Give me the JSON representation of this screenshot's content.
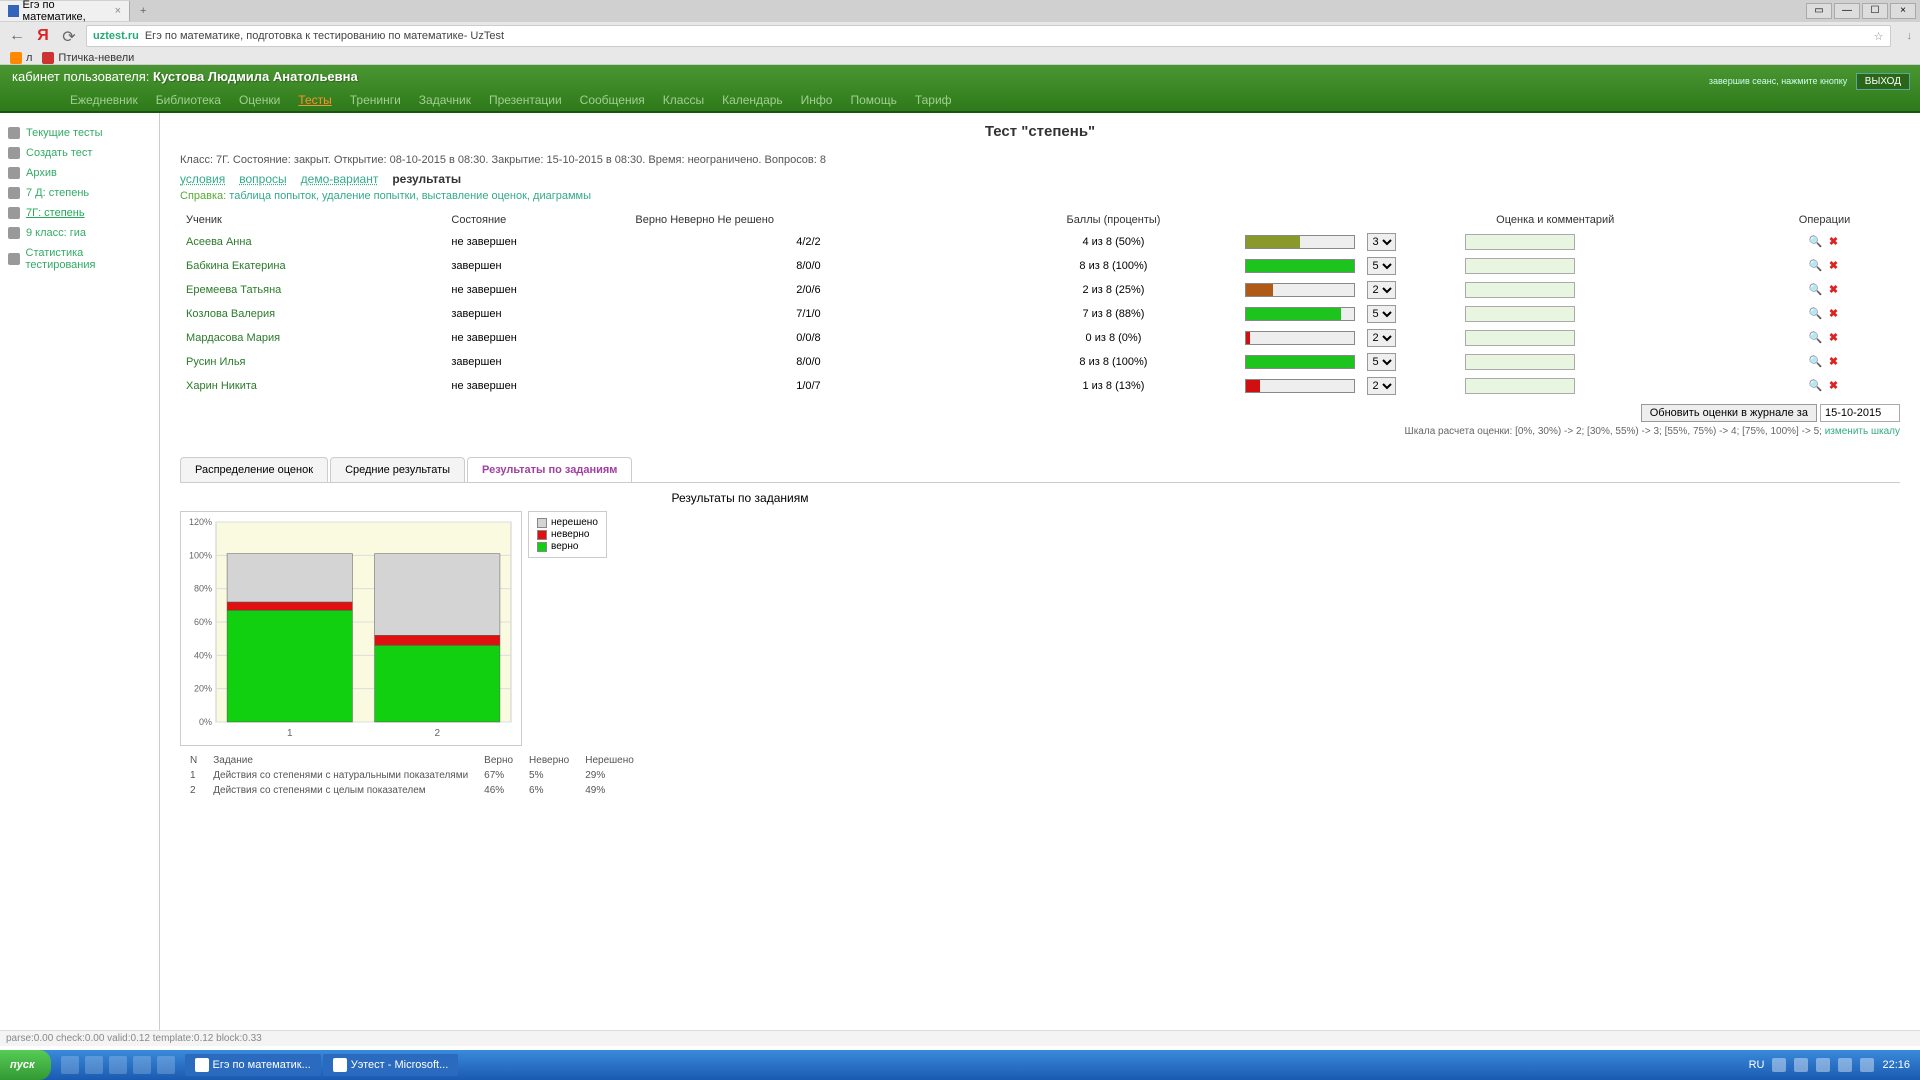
{
  "browser": {
    "tab_title": "Егэ по математике,",
    "url_domain": "uztest.ru",
    "url_title": "Егэ по математике, подготовка к тестированию по математике- UzTest",
    "bookmarks": [
      {
        "label": "л",
        "color": "#f80"
      },
      {
        "label": "Птичка-невели",
        "color": "#c33"
      }
    ]
  },
  "header": {
    "user_label": "кабинет пользователя:",
    "user_name": "Кустова Людмила Анатольевна",
    "logout_hint": "завершив сеанс, нажмите кнопку",
    "logout_btn": "ВЫХОД",
    "menu": [
      "Ежедневник",
      "Библиотека",
      "Оценки",
      "Тесты",
      "Тренинги",
      "Задачник",
      "Презентации",
      "Сообщения",
      "Классы",
      "Календарь",
      "Инфо",
      "Помощь",
      "Тариф"
    ],
    "menu_active": 3
  },
  "sidebar": [
    "Текущие тесты",
    "Создать тест",
    "Архив",
    "7 Д: степень",
    "7Г: степень",
    "9 класс: гиа",
    "Статистика тестирования"
  ],
  "sidebar_active": 4,
  "test": {
    "title": "Тест \"степень\"",
    "info": "Класс: 7Г. Состояние: закрыт. Открытие: 08-10-2015 в 08:30. Закрытие: 15-10-2015 в 08:30. Время: неограничено. Вопросов: 8",
    "subtabs": [
      "условия",
      "вопросы",
      "демо-вариант",
      "результаты"
    ],
    "subtab_active": 3,
    "help_label": "Справка:",
    "help_text": "таблица попыток, удаление попытки, выставление оценок, диаграммы"
  },
  "table": {
    "headers": {
      "student": "Ученик",
      "state": "Состояние",
      "vnr": "Верно Неверно Не решено",
      "points": "Баллы (проценты)",
      "grade": "Оценка и комментарий",
      "ops": "Операции"
    },
    "rows": [
      {
        "name": "Асеева Анна",
        "state": "не завершен",
        "vnr": "4/2/2",
        "points": "4 из 8 (50%)",
        "pct": 50,
        "color": "#8a9a2a",
        "grade": "3"
      },
      {
        "name": "Бабкина Екатерина",
        "state": "завершен",
        "vnr": "8/0/0",
        "points": "8 из 8 (100%)",
        "pct": 100,
        "color": "#1ec41e",
        "grade": "5"
      },
      {
        "name": "Еремеева Татьяна",
        "state": "не завершен",
        "vnr": "2/0/6",
        "points": "2 из 8 (25%)",
        "pct": 25,
        "color": "#b05a18",
        "grade": "2"
      },
      {
        "name": "Козлова Валерия",
        "state": "завершен",
        "vnr": "7/1/0",
        "points": "7 из 8 (88%)",
        "pct": 88,
        "color": "#1ec41e",
        "grade": "5"
      },
      {
        "name": "Мардасова Мария",
        "state": "не завершен",
        "vnr": "0/0/8",
        "points": "0 из 8 (0%)",
        "pct": 3,
        "color": "#d01010",
        "grade": "2"
      },
      {
        "name": "Русин Илья",
        "state": "завершен",
        "vnr": "8/0/0",
        "points": "8 из 8 (100%)",
        "pct": 100,
        "color": "#1ec41e",
        "grade": "5"
      },
      {
        "name": "Харин Никита",
        "state": "не завершен",
        "vnr": "1/0/7",
        "points": "1 из 8 (13%)",
        "pct": 13,
        "color": "#d01010",
        "grade": "2"
      }
    ],
    "update_btn": "Обновить оценки в журнале за",
    "update_date": "15-10-2015",
    "scale": "Шкала расчета оценки: [0%, 30%) -> 2; [30%, 55%) -> 3; [55%, 75%) -> 4; [75%, 100%] -> 5;",
    "scale_link": "изменить шкалу"
  },
  "chart_tabs": [
    "Распределение оценок",
    "Средние результаты",
    "Результаты по заданиям"
  ],
  "chart_tab_active": 2,
  "chart_data": {
    "type": "bar",
    "title": "Результаты по заданиям",
    "xlabel": "",
    "ylabel": "",
    "ylim": [
      0,
      120
    ],
    "yticks": [
      0,
      20,
      40,
      60,
      80,
      100,
      120
    ],
    "categories": [
      "1",
      "2"
    ],
    "series": [
      {
        "name": "верно",
        "color": "#10d010",
        "values": [
          67,
          46
        ]
      },
      {
        "name": "неверно",
        "color": "#e01010",
        "values": [
          5,
          6
        ]
      },
      {
        "name": "нерешено",
        "color": "#d4d4d4",
        "values": [
          29,
          49
        ]
      }
    ],
    "legend": [
      "нерешено",
      "неверно",
      "верно"
    ],
    "table_header": [
      "N",
      "Задание",
      "Верно",
      "Неверно",
      "Нерешено"
    ],
    "table_rows": [
      [
        "1",
        "Действия со степенями с натуральными показателями",
        "67%",
        "5%",
        "29%"
      ],
      [
        "2",
        "Действия со степенями с целым показателем",
        "46%",
        "6%",
        "49%"
      ]
    ]
  },
  "status": "parse:0.00   check:0.00   valid:0.12   template:0.12   block:0.33",
  "taskbar": {
    "start": "пуск",
    "tasks": [
      {
        "label": "Егэ по математик..."
      },
      {
        "label": "Уэтест - Microsoft..."
      }
    ],
    "lang": "RU",
    "time": "22:16"
  }
}
